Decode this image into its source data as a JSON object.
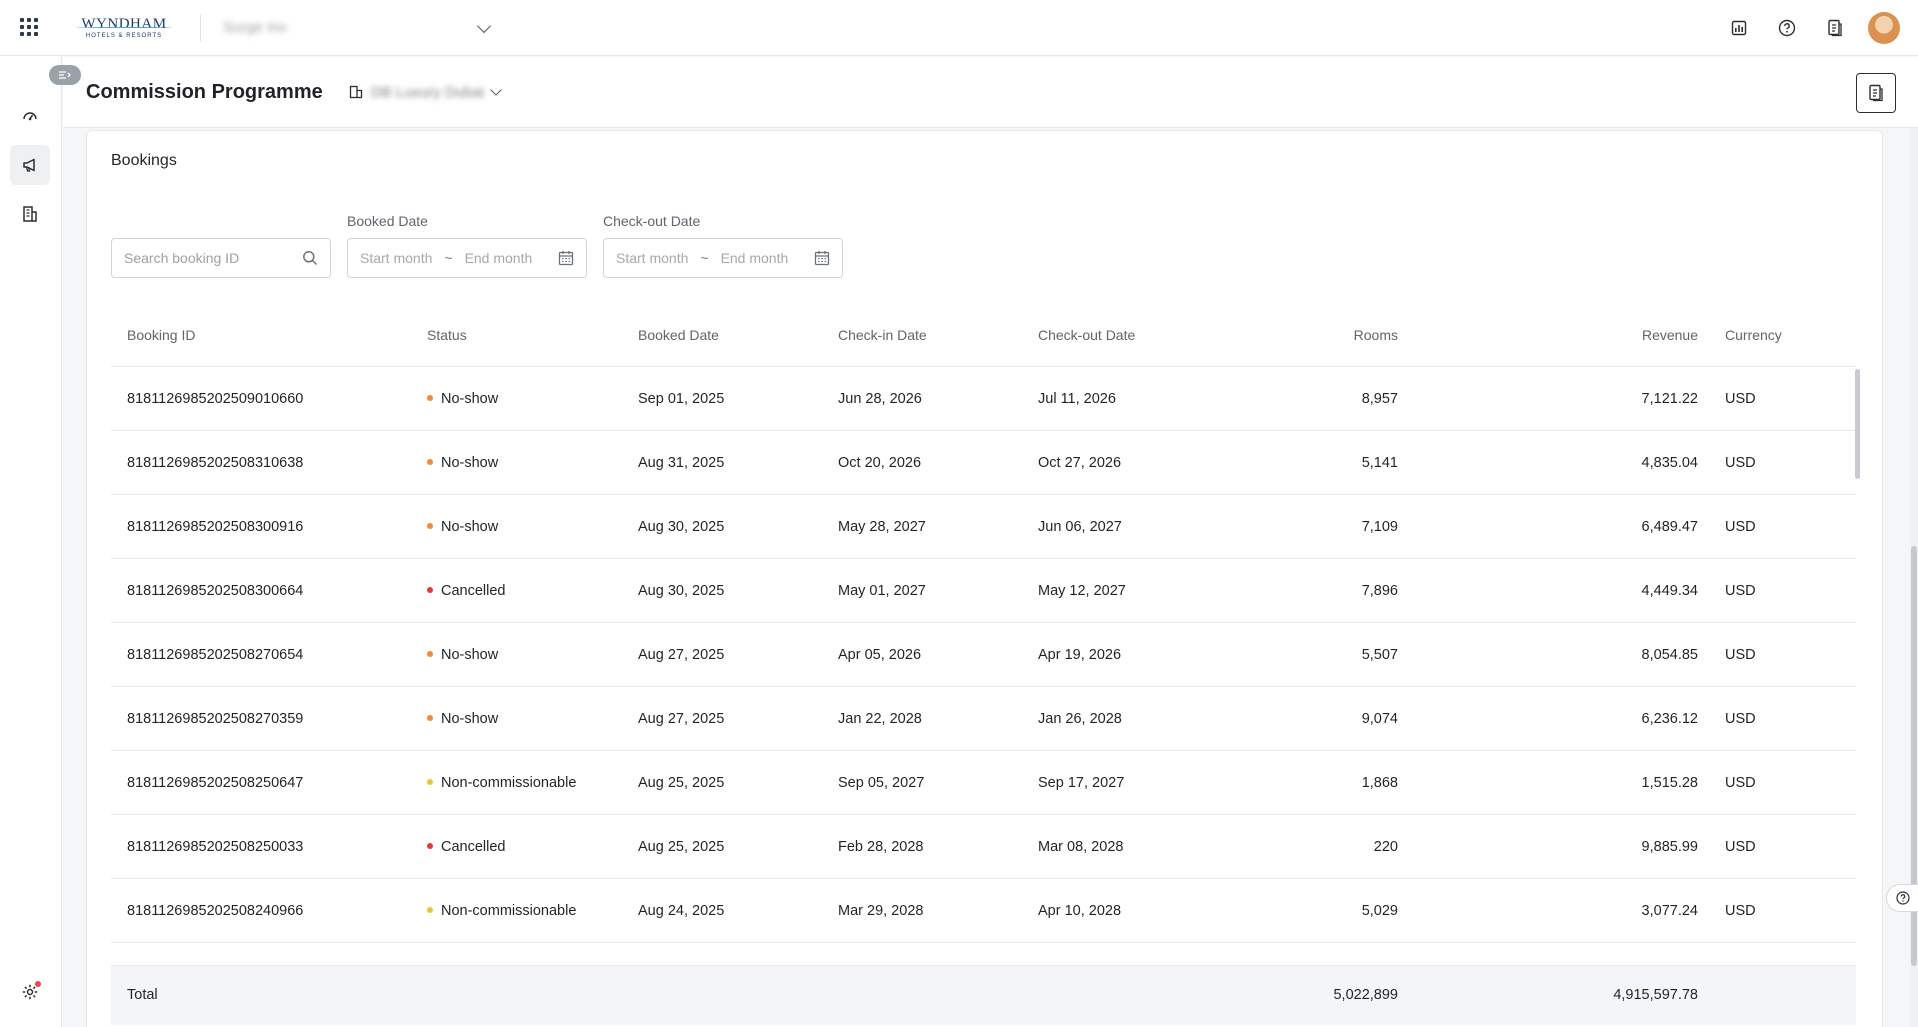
{
  "topbar": {
    "brand_name": "WYNDHAM",
    "brand_sub": "HOTELS & RESORTS",
    "property_selected": "Surge Inc",
    "icons": [
      "apps-grid-icon",
      "analytics-icon",
      "help-icon",
      "document-icon"
    ]
  },
  "sidebar": {
    "items": [
      "dashboard-icon",
      "megaphone-icon",
      "building-icon"
    ],
    "bottom": "settings-icon"
  },
  "header": {
    "title": "Commission Programme",
    "hotel_selected": "DB Luxury Dubai"
  },
  "bookings": {
    "title": "Bookings",
    "search_placeholder": "Search booking ID",
    "booked_date_label": "Booked Date",
    "checkout_date_label": "Check-out Date",
    "start_placeholder": "Start month",
    "end_placeholder": "End month",
    "range_separator": "~",
    "columns": [
      "Booking ID",
      "Status",
      "Booked Date",
      "Check-in Date",
      "Check-out Date",
      "Rooms",
      "Revenue",
      "Currency"
    ],
    "rows": [
      {
        "id": "8181126985202509010660",
        "status": "No-show",
        "booked": "Sep 01, 2025",
        "checkin": "Jun 28, 2026",
        "checkout": "Jul 11, 2026",
        "rooms": "8,957",
        "revenue": "7,121.22",
        "currency": "USD"
      },
      {
        "id": "8181126985202508310638",
        "status": "No-show",
        "booked": "Aug 31, 2025",
        "checkin": "Oct 20, 2026",
        "checkout": "Oct 27, 2026",
        "rooms": "5,141",
        "revenue": "4,835.04",
        "currency": "USD"
      },
      {
        "id": "8181126985202508300916",
        "status": "No-show",
        "booked": "Aug 30, 2025",
        "checkin": "May 28, 2027",
        "checkout": "Jun 06, 2027",
        "rooms": "7,109",
        "revenue": "6,489.47",
        "currency": "USD"
      },
      {
        "id": "8181126985202508300664",
        "status": "Cancelled",
        "booked": "Aug 30, 2025",
        "checkin": "May 01, 2027",
        "checkout": "May 12, 2027",
        "rooms": "7,896",
        "revenue": "4,449.34",
        "currency": "USD"
      },
      {
        "id": "8181126985202508270654",
        "status": "No-show",
        "booked": "Aug 27, 2025",
        "checkin": "Apr 05, 2026",
        "checkout": "Apr 19, 2026",
        "rooms": "5,507",
        "revenue": "8,054.85",
        "currency": "USD"
      },
      {
        "id": "8181126985202508270359",
        "status": "No-show",
        "booked": "Aug 27, 2025",
        "checkin": "Jan 22, 2028",
        "checkout": "Jan 26, 2028",
        "rooms": "9,074",
        "revenue": "6,236.12",
        "currency": "USD"
      },
      {
        "id": "8181126985202508250647",
        "status": "Non-commissionable",
        "booked": "Aug 25, 2025",
        "checkin": "Sep 05, 2027",
        "checkout": "Sep 17, 2027",
        "rooms": "1,868",
        "revenue": "1,515.28",
        "currency": "USD"
      },
      {
        "id": "8181126985202508250033",
        "status": "Cancelled",
        "booked": "Aug 25, 2025",
        "checkin": "Feb 28, 2028",
        "checkout": "Mar 08, 2028",
        "rooms": "220",
        "revenue": "9,885.99",
        "currency": "USD"
      },
      {
        "id": "8181126985202508240966",
        "status": "Non-commissionable",
        "booked": "Aug 24, 2025",
        "checkin": "Mar 29, 2028",
        "checkout": "Apr 10, 2028",
        "rooms": "5,029",
        "revenue": "3,077.24",
        "currency": "USD"
      }
    ],
    "total": {
      "label": "Total",
      "rooms": "5,022,899",
      "revenue": "4,915,597.78"
    }
  },
  "colors": {
    "No-show": "#f08c2e",
    "Cancelled": "#e5383b",
    "Non-commissionable": "#f2c12e"
  }
}
